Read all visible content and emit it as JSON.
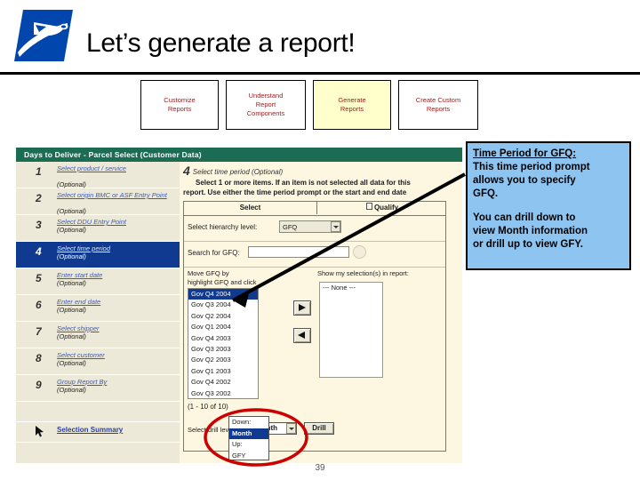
{
  "slide": {
    "title": "Let’s generate a report!",
    "page_number": "39",
    "logo_name": "usps-eagle-logo"
  },
  "nav_buttons": [
    {
      "label": "Customize\nReports",
      "line1": "Customize",
      "line2": "Reports",
      "line3": "",
      "active": false
    },
    {
      "label": "Understand Report Components",
      "line1": "Understand",
      "line2": "Report",
      "line3": "Components",
      "active": false
    },
    {
      "label": "Generate Reports",
      "line1": "Generate",
      "line2": "Reports",
      "line3": "",
      "active": true
    },
    {
      "label": "Create Custom Reports",
      "line1": "Create Custom",
      "line2": "Reports",
      "line3": "",
      "active": false
    }
  ],
  "app": {
    "titlebar": "Days to Deliver - Parcel Select (Customer Data)",
    "steps": [
      {
        "num": "1",
        "label": "Select product / service",
        "optional": "(Optional)",
        "selected": false
      },
      {
        "num": "2",
        "label": "Select origin BMC or ASF Entry Point",
        "optional": "(Optional)",
        "selected": false
      },
      {
        "num": "3",
        "label": "Select DDU Entry Point",
        "optional": "(Optional)",
        "selected": false
      },
      {
        "num": "4",
        "label": "Select time period",
        "optional": "(Optional)",
        "selected": true
      },
      {
        "num": "5",
        "label": "Enter start date",
        "optional": "(Optional)",
        "selected": false
      },
      {
        "num": "6",
        "label": "Enter end date",
        "optional": "(Optional)",
        "selected": false
      },
      {
        "num": "7",
        "label": "Select shipper",
        "optional": "(Optional)",
        "selected": false
      },
      {
        "num": "8",
        "label": "Select customer",
        "optional": "(Optional)",
        "selected": false
      },
      {
        "num": "9",
        "label": "Group Report By",
        "optional": "(Optional)",
        "selected": false
      }
    ],
    "selection_summary": "Selection Summary",
    "prompt": {
      "step_number": "4",
      "heading": "Select time period (Optional)",
      "instruction_line1": "Select 1 or more items. If an item is not selected all data for this",
      "instruction_line2": "report. Use either the time period prompt or the start and end date"
    },
    "tabs": {
      "select": "Select",
      "qualify": "Qualify"
    },
    "fields": {
      "hierarchy_label": "Select hierarchy level:",
      "hierarchy_value": "GFQ",
      "search_label": "Search for GFQ:",
      "search_value": "",
      "search_placeholder": ""
    },
    "move_text_line1": "Move GFQ by",
    "move_text_line2": "highlight GFQ and click",
    "gfq_items": [
      {
        "label": "Gov Q4 2004",
        "selected": true
      },
      {
        "label": "Gov Q3 2004",
        "selected": false
      },
      {
        "label": "Gov Q2 2004",
        "selected": false
      },
      {
        "label": "Gov Q1 2004",
        "selected": false
      },
      {
        "label": "Gov Q4 2003",
        "selected": false
      },
      {
        "label": "Gov Q3 2003",
        "selected": false
      },
      {
        "label": "Gov Q2 2003",
        "selected": false
      },
      {
        "label": "Gov Q1 2003",
        "selected": false
      },
      {
        "label": "Gov Q4 2002",
        "selected": false
      },
      {
        "label": "Gov Q3 2002",
        "selected": false
      }
    ],
    "gfq_count": "(1 - 10 of 10)",
    "show_selection_label": "Show my selection(s) in report:",
    "selection_items": [
      "--- None ---"
    ],
    "drill": {
      "label": "Select drill level:",
      "value": "Month",
      "button": "Drill",
      "options": [
        {
          "label": "Down:",
          "selected": false
        },
        {
          "label": "Month",
          "selected": true
        },
        {
          "label": "Up:",
          "selected": false
        },
        {
          "label": "GFY",
          "selected": false
        }
      ]
    }
  },
  "callout": {
    "title": "Time Period for GFQ:",
    "para1_line1": "This time period prompt",
    "para1_line2": "allows you to specify",
    "para1_line3": "GFQ.",
    "para2_line1": "You can drill down to",
    "para2_line2": "view Month information",
    "para2_line3": "or drill up to view GFY."
  },
  "colors": {
    "callout_bg": "#8EC5F0",
    "app_titlebar": "#1C6B53",
    "step_selected": "#103A8F",
    "nav_active": "#FFFFCC",
    "nav_text": "#9A2020",
    "annotation_red": "#CC0000",
    "logo_blue": "#0046AD"
  }
}
